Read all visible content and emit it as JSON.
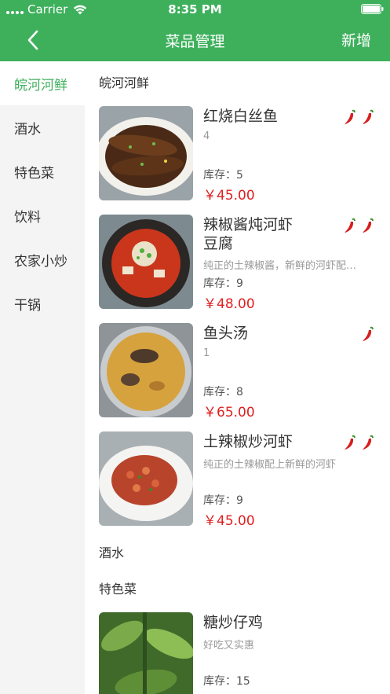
{
  "status_bar": {
    "carrier": "Carrier",
    "time": "8:35 PM"
  },
  "nav": {
    "title": "菜品管理",
    "add_label": "新增"
  },
  "colors": {
    "brand": "#3eb05c",
    "price": "#e02020",
    "chili": "#d81e1e"
  },
  "sidebar": {
    "items": [
      {
        "label": "皖河河鲜",
        "active": true
      },
      {
        "label": "酒水",
        "active": false
      },
      {
        "label": "特色菜",
        "active": false
      },
      {
        "label": "饮料",
        "active": false
      },
      {
        "label": "农家小炒",
        "active": false
      },
      {
        "label": "干锅",
        "active": false
      }
    ]
  },
  "sections": [
    {
      "title": "皖河河鲜",
      "dishes": [
        {
          "name": "红烧白丝鱼",
          "desc": "4",
          "stock_label": "库存：",
          "stock": "5",
          "price": "￥45.00",
          "spicy_level": 2
        },
        {
          "name": "辣椒酱炖河虾豆腐",
          "desc": "纯正的土辣椒酱，新鲜的河虾配…",
          "stock_label": "库存：",
          "stock": "9",
          "price": "￥48.00",
          "spicy_level": 2
        },
        {
          "name": "鱼头汤",
          "desc": "1",
          "stock_label": "库存：",
          "stock": "8",
          "price": "￥65.00",
          "spicy_level": 1
        },
        {
          "name": "土辣椒炒河虾",
          "desc": "纯正的土辣椒配上新鲜的河虾",
          "stock_label": "库存：",
          "stock": "9",
          "price": "￥45.00",
          "spicy_level": 2
        }
      ]
    },
    {
      "title": "酒水",
      "dishes": []
    },
    {
      "title": "特色菜",
      "dishes": [
        {
          "name": "糖炒仔鸡",
          "desc": "好吃又实惠",
          "stock_label": "库存：",
          "stock": "15",
          "price": "",
          "spicy_level": 0
        }
      ]
    }
  ]
}
